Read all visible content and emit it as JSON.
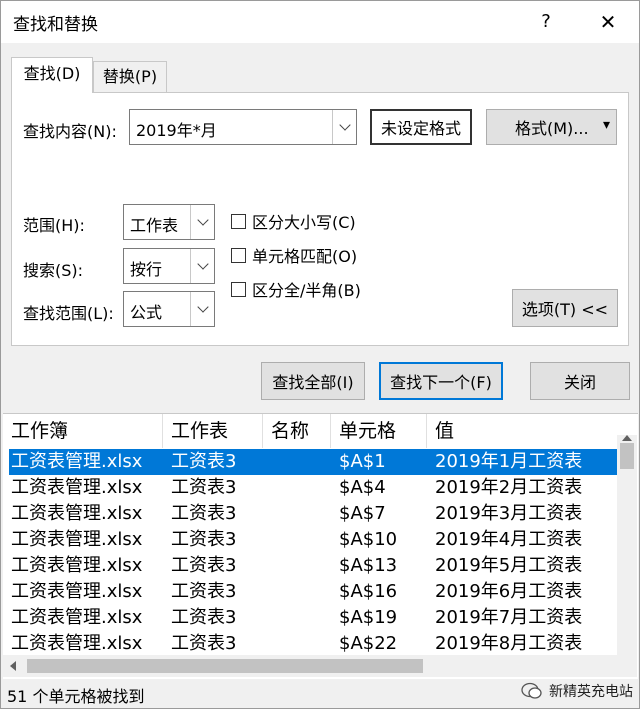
{
  "window": {
    "title": "查找和替换",
    "help": "?",
    "close": "✕"
  },
  "tabs": [
    {
      "label": "查找(D)",
      "active": true
    },
    {
      "label": "替换(P)",
      "active": false
    }
  ],
  "find": {
    "label": "查找内容(N):",
    "value": "2019年*月",
    "format_preview": "未设定格式",
    "format_button": "格式(M)...",
    "format_arrow": "▾"
  },
  "options": {
    "scope_label": "范围(H):",
    "scope_value": "工作表",
    "search_label": "搜索(S):",
    "search_value": "按行",
    "lookin_label": "查找范围(L):",
    "lookin_value": "公式",
    "match_case": "区分大小写(C)",
    "match_cell": "单元格匹配(O)",
    "match_width": "区分全/半角(B)",
    "options_button": "选项(T) <<"
  },
  "actions": {
    "find_all": "查找全部(I)",
    "find_next": "查找下一个(F)",
    "close": "关闭"
  },
  "results": {
    "columns": [
      "工作簿",
      "工作表",
      "名称",
      "单元格",
      "值"
    ],
    "rows": [
      [
        "工资表管理.xlsx",
        "工资表3",
        "",
        "$A$1",
        "2019年1月工资表"
      ],
      [
        "工资表管理.xlsx",
        "工资表3",
        "",
        "$A$4",
        "2019年2月工资表"
      ],
      [
        "工资表管理.xlsx",
        "工资表3",
        "",
        "$A$7",
        "2019年3月工资表"
      ],
      [
        "工资表管理.xlsx",
        "工资表3",
        "",
        "$A$10",
        "2019年4月工资表"
      ],
      [
        "工资表管理.xlsx",
        "工资表3",
        "",
        "$A$13",
        "2019年5月工资表"
      ],
      [
        "工资表管理.xlsx",
        "工资表3",
        "",
        "$A$16",
        "2019年6月工资表"
      ],
      [
        "工资表管理.xlsx",
        "工资表3",
        "",
        "$A$19",
        "2019年7月工资表"
      ],
      [
        "工资表管理.xlsx",
        "工资表3",
        "",
        "$A$22",
        "2019年8月工资表"
      ]
    ],
    "selected_index": 0
  },
  "status": "51 个单元格被找到",
  "watermark": "新精英充电站",
  "colors": {
    "accent": "#0078d7",
    "dialog_bg": "#f0f0f0"
  }
}
